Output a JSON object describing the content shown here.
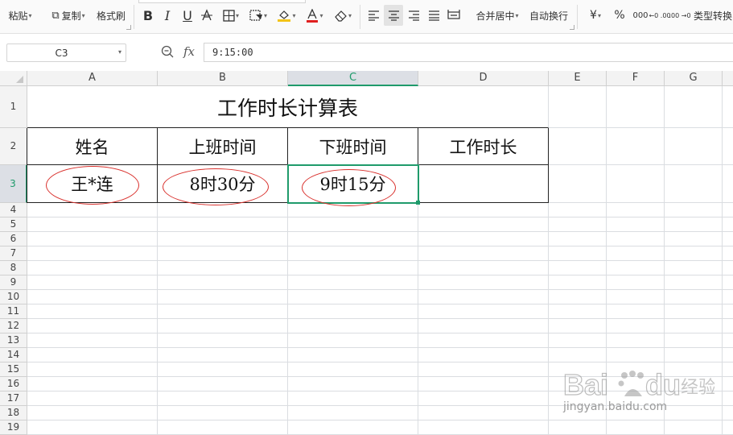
{
  "toolbar": {
    "paste_label": "粘贴",
    "copy_label": "复制",
    "format_painter_label": "格式刷",
    "bold_label": "B",
    "italic_label": "I",
    "underline_label": "U",
    "merge_center_label": "合并居中",
    "wrap_text_label": "自动换行",
    "currency_label": "¥",
    "percent_label": "%",
    "thousands_label": "000",
    "inc_decimal_label": "←0 .00",
    "dec_decimal_label": ".00 →0",
    "type_convert_label": "类型转换",
    "colors": {
      "highlight": "#f3c318",
      "font_color": "#e02020"
    }
  },
  "formula_bar": {
    "name_box": "C3",
    "fx_label": "fx",
    "formula": "9:15:00"
  },
  "sheet": {
    "columns": [
      "A",
      "B",
      "C",
      "D",
      "E",
      "F",
      "G"
    ],
    "selected_column": "C",
    "rows": [
      "1",
      "2",
      "3",
      "4",
      "5",
      "6",
      "7",
      "8",
      "9",
      "10",
      "11",
      "12",
      "13",
      "14",
      "15",
      "16",
      "17",
      "18",
      "19"
    ],
    "selected_row": "3",
    "title": "工作时长计算表",
    "headers": [
      "姓名",
      "上班时间",
      "下班时间",
      "工作时长"
    ],
    "row3": [
      "王*连",
      "8时30分",
      "9时15分",
      ""
    ],
    "selection_color": "#1f9b6b",
    "annotation_color": "#d9302c"
  },
  "watermark": {
    "logo_text": "Bai du 经验",
    "url": "jingyan.baidu.com"
  }
}
